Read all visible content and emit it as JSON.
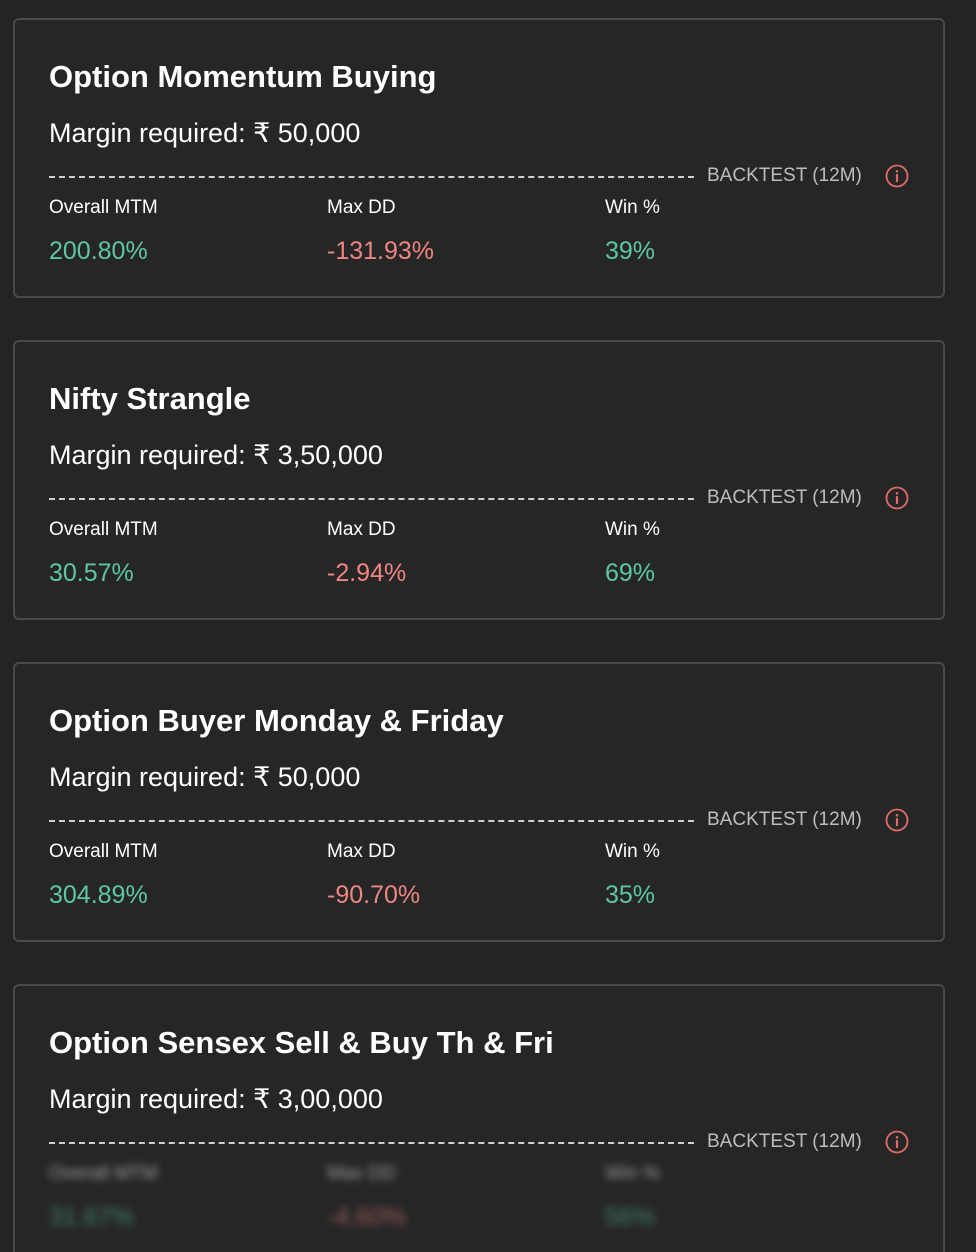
{
  "colors": {
    "background": "#242424",
    "card_border": "#4a4a4a",
    "positive": "#5cc6a6",
    "negative": "#ef8580",
    "info_icon": "#e26d67"
  },
  "backtest_label": "BACKTEST (12M)",
  "metric_labels": {
    "mtm": "Overall MTM",
    "dd": "Max DD",
    "win": "Win %"
  },
  "strategies": [
    {
      "title": "Option Momentum Buying",
      "margin": "Margin required: ₹ 50,000",
      "mtm": "200.80%",
      "dd": "-131.93%",
      "win": "39%"
    },
    {
      "title": "Nifty Strangle",
      "margin": "Margin required: ₹ 3,50,000",
      "mtm": "30.57%",
      "dd": "-2.94%",
      "win": "69%"
    },
    {
      "title": "Option Buyer Monday & Friday",
      "margin": "Margin required: ₹ 50,000",
      "mtm": "304.89%",
      "dd": "-90.70%",
      "win": "35%"
    },
    {
      "title": "Option Sensex Sell & Buy Th & Fri",
      "margin": "Margin required: ₹ 3,00,000",
      "mtm": "31.67%",
      "dd": "-4.60%",
      "win": "56%",
      "metrics_blurred": true
    }
  ]
}
